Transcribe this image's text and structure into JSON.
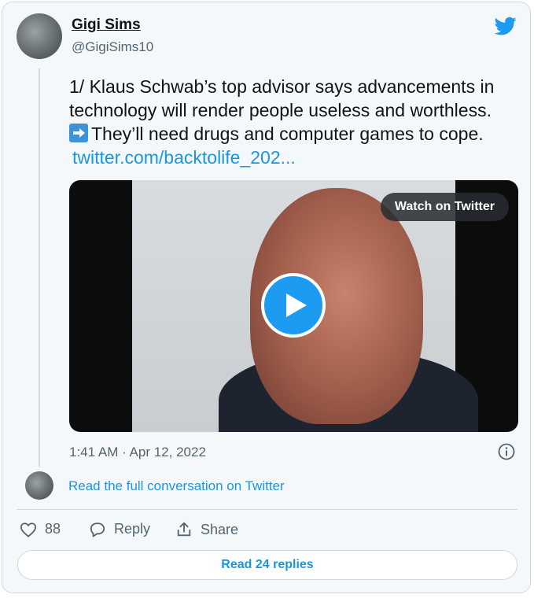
{
  "author": {
    "name": "Gigi Sims",
    "handle": "@GigiSims10"
  },
  "tweet": {
    "line1": "1/ Klaus Schwab’s top advisor says advancements in",
    "line2": "technology will render people useless and worthless.",
    "line3": "They’ll need drugs and computer games to cope.",
    "link": "twitter.com/backtolife_202..."
  },
  "media": {
    "watch_label": "Watch on Twitter"
  },
  "timestamp": "1:41 AM · Apr 12, 2022",
  "conversation_link": "Read the full conversation on Twitter",
  "actions": {
    "like_count": "88",
    "reply_label": "Reply",
    "share_label": "Share"
  },
  "replies_button": "Read 24 replies",
  "colors": {
    "brand": "#1d9bf0",
    "link": "#1b95e0",
    "text": "#0f1419",
    "muted": "#536471"
  },
  "icons": [
    "twitter-bird-icon",
    "arrow-right-icon",
    "play-icon",
    "info-icon",
    "heart-icon",
    "reply-icon",
    "share-icon"
  ]
}
